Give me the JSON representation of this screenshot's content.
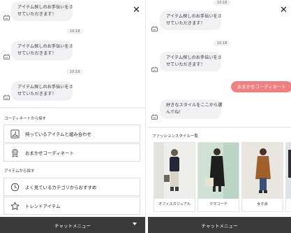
{
  "left": {
    "messages": [
      {
        "lines": [
          "アイテム探しのお手伝いをさ",
          "せていただきます！"
        ]
      },
      {
        "lines": [
          "アイテム探しのお手伝いをさ",
          "せていただきます！"
        ]
      },
      {
        "lines": [
          "アイテム探しのお手伝いをさ",
          "せていただきます！"
        ]
      }
    ],
    "timestamps": [
      "10:18",
      "10:19"
    ],
    "section_coordinate": "コーディネートから探す",
    "section_item": "アイテムから探す",
    "menu": [
      {
        "label": "持っているアイテムと組み合わせ",
        "icon": "hanger-icon"
      },
      {
        "label": "おまかせコーディネート",
        "icon": "medal-icon"
      },
      {
        "label": "よく見ているカテゴリからおすすめ",
        "icon": "clock-icon"
      },
      {
        "label": "トレンドアイテム",
        "icon": "star-icon"
      }
    ],
    "chat_menu_label": "チャットメニュー"
  },
  "right": {
    "timestamps": [
      "10:18",
      "10:18"
    ],
    "messages": [
      {
        "lines": [
          "アイテム探しのお手伝いをさ",
          "せていただきます！"
        ]
      },
      {
        "lines": [
          "アイテム探しのお手伝いをさ",
          "せていただきます！"
        ]
      },
      {
        "lines": [
          "好きなスタイルをここから選",
          "んでね！"
        ]
      }
    ],
    "user_message": "おまかせコーディネート",
    "section_style": "ファッションスタイル一覧",
    "styles": [
      {
        "label": "オフィスカジュアル"
      },
      {
        "label": "ママコーデ"
      },
      {
        "label": "女子会"
      }
    ],
    "chat_menu_label": "チャットメニュー"
  },
  "colors": {
    "bubble_bg": "#f1f1f3",
    "user_bubble_bg": "#f08080",
    "menu_bar_bg": "#3a3a3a"
  }
}
